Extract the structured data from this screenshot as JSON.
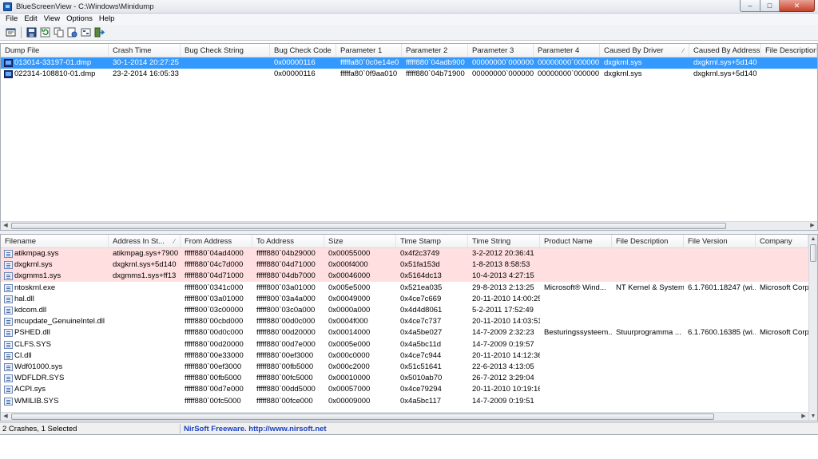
{
  "window": {
    "title": "BlueScreenView  -  C:\\Windows\\Minidump",
    "min_symbol": "–",
    "max_symbol": "□",
    "close_symbol": "✕"
  },
  "menu": [
    "File",
    "Edit",
    "View",
    "Options",
    "Help"
  ],
  "toolbar": [
    {
      "name": "properties-icon"
    },
    {
      "name": "save-icon"
    },
    {
      "name": "refresh-icon"
    },
    {
      "name": "copy-icon"
    },
    {
      "name": "html-report-icon"
    },
    {
      "name": "advanced-options-icon"
    },
    {
      "name": "exit-icon"
    }
  ],
  "crash_list": {
    "columns": [
      "Dump File",
      "Crash Time",
      "Bug Check String",
      "Bug Check Code",
      "Parameter 1",
      "Parameter 2",
      "Parameter 3",
      "Parameter 4",
      "Caused By Driver",
      "Caused By Address",
      "File Description"
    ],
    "sort_symbol": "∕",
    "rows": [
      [
        "013014-33197-01.dmp",
        "30-1-2014 20:27:25",
        "",
        "0x00000116",
        "fffffa80`0c0e14e0",
        "fffff880`04adb900",
        "00000000`000000...",
        "00000000`000000...",
        "dxgkrnl.sys",
        "dxgkrnl.sys+5d140",
        ""
      ],
      [
        "022314-108810-01.dmp",
        "23-2-2014 16:05:33",
        "",
        "0x00000116",
        "fffffa80`0f9aa010",
        "fffff880`04b71900",
        "00000000`000000...",
        "00000000`000000...",
        "dxgkrnl.sys",
        "dxgkrnl.sys+5d140",
        ""
      ]
    ]
  },
  "driver_list": {
    "columns": [
      "Filename",
      "Address In St...",
      "From Address",
      "To Address",
      "Size",
      "Time Stamp",
      "Time String",
      "Product Name",
      "File Description",
      "File Version",
      "Company"
    ],
    "sort_symbol": "∕",
    "rows": [
      [
        "atikmpag.sys",
        "atikmpag.sys+7900",
        "fffff880`04ad4000",
        "fffff880`04b29000",
        "0x00055000",
        "0x4f2c3749",
        "3-2-2012 20:36:41",
        "",
        "",
        "",
        ""
      ],
      [
        "dxgkrnl.sys",
        "dxgkrnl.sys+5d140",
        "fffff880`04c7d000",
        "fffff880`04d71000",
        "0x000f4000",
        "0x51fa153d",
        "1-8-2013 8:58:53",
        "",
        "",
        "",
        ""
      ],
      [
        "dxgmms1.sys",
        "dxgmms1.sys+ff13",
        "fffff880`04d71000",
        "fffff880`04db7000",
        "0x00046000",
        "0x5164dc13",
        "10-4-2013 4:27:15",
        "",
        "",
        "",
        ""
      ],
      [
        "ntoskrnl.exe",
        "",
        "fffff800`0341c000",
        "fffff800`03a01000",
        "0x005e5000",
        "0x521ea035",
        "29-8-2013 2:13:25",
        "Microsoft® Wind...",
        "NT Kernel & System",
        "6.1.7601.18247 (wi...",
        "Microsoft Corp"
      ],
      [
        "hal.dll",
        "",
        "fffff800`03a01000",
        "fffff800`03a4a000",
        "0x00049000",
        "0x4ce7c669",
        "20-11-2010 14:00:25",
        "",
        "",
        "",
        ""
      ],
      [
        "kdcom.dll",
        "",
        "fffff800`03c00000",
        "fffff800`03c0a000",
        "0x0000a000",
        "0x4d4d8061",
        "5-2-2011 17:52:49",
        "",
        "",
        "",
        ""
      ],
      [
        "mcupdate_GenuineIntel.dll",
        "",
        "fffff880`00cbd000",
        "fffff880`00d0c000",
        "0x0004f000",
        "0x4ce7c737",
        "20-11-2010 14:03:51",
        "",
        "",
        "",
        ""
      ],
      [
        "PSHED.dll",
        "",
        "fffff880`00d0c000",
        "fffff880`00d20000",
        "0x00014000",
        "0x4a5be027",
        "14-7-2009 2:32:23",
        "Besturingssysteem...",
        "Stuurprogramma ...",
        "6.1.7600.16385 (wi...",
        "Microsoft Corp"
      ],
      [
        "CLFS.SYS",
        "",
        "fffff880`00d20000",
        "fffff880`00d7e000",
        "0x0005e000",
        "0x4a5bc11d",
        "14-7-2009 0:19:57",
        "",
        "",
        "",
        ""
      ],
      [
        "CI.dll",
        "",
        "fffff880`00e33000",
        "fffff880`00ef3000",
        "0x000c0000",
        "0x4ce7c944",
        "20-11-2010 14:12:36",
        "",
        "",
        "",
        ""
      ],
      [
        "Wdf01000.sys",
        "",
        "fffff880`00ef3000",
        "fffff880`00fb5000",
        "0x000c2000",
        "0x51c51641",
        "22-6-2013 4:13:05",
        "",
        "",
        "",
        ""
      ],
      [
        "WDFLDR.SYS",
        "",
        "fffff880`00fb5000",
        "fffff880`00fc5000",
        "0x00010000",
        "0x5010ab70",
        "26-7-2012 3:29:04",
        "",
        "",
        "",
        ""
      ],
      [
        "ACPI.sys",
        "",
        "fffff880`00d7e000",
        "fffff880`00dd5000",
        "0x00057000",
        "0x4ce79294",
        "20-11-2010 10:19:16",
        "",
        "",
        "",
        ""
      ],
      [
        "WMILIB.SYS",
        "",
        "fffff880`00fc5000",
        "fffff880`00fce000",
        "0x00009000",
        "0x4a5bc117",
        "14-7-2009 0:19:51",
        "",
        "",
        "",
        ""
      ]
    ]
  },
  "status": {
    "left": "2 Crashes, 1 Selected",
    "link": "NirSoft Freeware.  http://www.nirsoft.net"
  }
}
